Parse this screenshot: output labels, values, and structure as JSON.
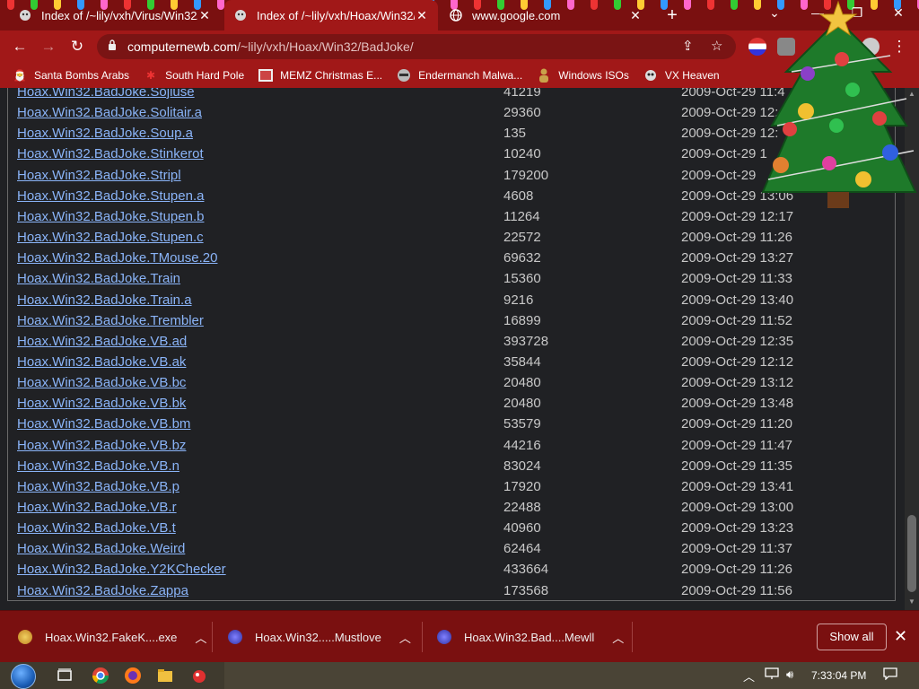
{
  "tabs": [
    {
      "title": "Index of /~lily/vxh/Virus/Win32/",
      "active": false
    },
    {
      "title": "Index of /~lily/vxh/Hoax/Win32/",
      "active": true
    },
    {
      "title": "www.google.com",
      "active": false
    }
  ],
  "toolbar": {
    "url_host": "computernewb.com",
    "url_path": "/~lily/vxh/Hoax/Win32/BadJoke/"
  },
  "bookmarks": [
    {
      "label": "Santa Bombs Arabs",
      "icon": "santa-icon"
    },
    {
      "label": "South Hard Pole",
      "icon": "snowflake-icon"
    },
    {
      "label": "MEMZ Christmas E...",
      "icon": "image-icon"
    },
    {
      "label": "Endermanch Malwa...",
      "icon": "raccoon-icon"
    },
    {
      "label": "Windows ISOs",
      "icon": "person-icon"
    },
    {
      "label": "VX Heaven",
      "icon": "skull-icon"
    }
  ],
  "files": [
    {
      "name": "Hoax.Win32.BadJoke.Sojiuse",
      "size": "41219",
      "date": "2009-Oct-29 11:4"
    },
    {
      "name": "Hoax.Win32.BadJoke.Solitair.a",
      "size": "29360",
      "date": "2009-Oct-29 12:4"
    },
    {
      "name": "Hoax.Win32.BadJoke.Soup.a",
      "size": "135",
      "date": "2009-Oct-29 12:"
    },
    {
      "name": "Hoax.Win32.BadJoke.Stinkerot",
      "size": "10240",
      "date": "2009-Oct-29 1"
    },
    {
      "name": "Hoax.Win32.BadJoke.Stripl",
      "size": "179200",
      "date": "2009-Oct-29"
    },
    {
      "name": "Hoax.Win32.BadJoke.Stupen.a",
      "size": "4608",
      "date": "2009-Oct-29 13:06"
    },
    {
      "name": "Hoax.Win32.BadJoke.Stupen.b",
      "size": "11264",
      "date": "2009-Oct-29 12:17"
    },
    {
      "name": "Hoax.Win32.BadJoke.Stupen.c",
      "size": "22572",
      "date": "2009-Oct-29 11:26"
    },
    {
      "name": "Hoax.Win32.BadJoke.TMouse.20",
      "size": "69632",
      "date": "2009-Oct-29 13:27"
    },
    {
      "name": "Hoax.Win32.BadJoke.Train",
      "size": "15360",
      "date": "2009-Oct-29 11:33"
    },
    {
      "name": "Hoax.Win32.BadJoke.Train.a",
      "size": "9216",
      "date": "2009-Oct-29 13:40"
    },
    {
      "name": "Hoax.Win32.BadJoke.Trembler",
      "size": "16899",
      "date": "2009-Oct-29 11:52"
    },
    {
      "name": "Hoax.Win32.BadJoke.VB.ad",
      "size": "393728",
      "date": "2009-Oct-29 12:35"
    },
    {
      "name": "Hoax.Win32.BadJoke.VB.ak",
      "size": "35844",
      "date": "2009-Oct-29 12:12"
    },
    {
      "name": "Hoax.Win32.BadJoke.VB.bc",
      "size": "20480",
      "date": "2009-Oct-29 13:12"
    },
    {
      "name": "Hoax.Win32.BadJoke.VB.bk",
      "size": "20480",
      "date": "2009-Oct-29 13:48"
    },
    {
      "name": "Hoax.Win32.BadJoke.VB.bm",
      "size": "53579",
      "date": "2009-Oct-29 11:20"
    },
    {
      "name": "Hoax.Win32.BadJoke.VB.bz",
      "size": "44216",
      "date": "2009-Oct-29 11:47"
    },
    {
      "name": "Hoax.Win32.BadJoke.VB.n",
      "size": "83024",
      "date": "2009-Oct-29 11:35"
    },
    {
      "name": "Hoax.Win32.BadJoke.VB.p",
      "size": "17920",
      "date": "2009-Oct-29 13:41"
    },
    {
      "name": "Hoax.Win32.BadJoke.VB.r",
      "size": "22488",
      "date": "2009-Oct-29 13:00"
    },
    {
      "name": "Hoax.Win32.BadJoke.VB.t",
      "size": "40960",
      "date": "2009-Oct-29 13:23"
    },
    {
      "name": "Hoax.Win32.BadJoke.Weird",
      "size": "62464",
      "date": "2009-Oct-29 11:37"
    },
    {
      "name": "Hoax.Win32.BadJoke.Y2KChecker",
      "size": "433664",
      "date": "2009-Oct-29 11:26"
    },
    {
      "name": "Hoax.Win32.BadJoke.Zappa",
      "size": "173568",
      "date": "2009-Oct-29 11:56"
    }
  ],
  "downloads": [
    {
      "name": "Hoax.Win32.FakeK....exe",
      "icon": "exe-file-icon"
    },
    {
      "name": "Hoax.Win32.....Mustlove",
      "icon": "app-file-icon"
    },
    {
      "name": "Hoax.Win32.Bad....Mewll",
      "icon": "app-file-icon"
    }
  ],
  "download_bar": {
    "show_all": "Show all"
  },
  "taskbar": {
    "clock": "7:33:04 PM"
  },
  "colors": {
    "tab_strip": "#7a1010",
    "toolbar": "#a11818",
    "link": "#8ab4f8",
    "page_bg": "#202124"
  }
}
